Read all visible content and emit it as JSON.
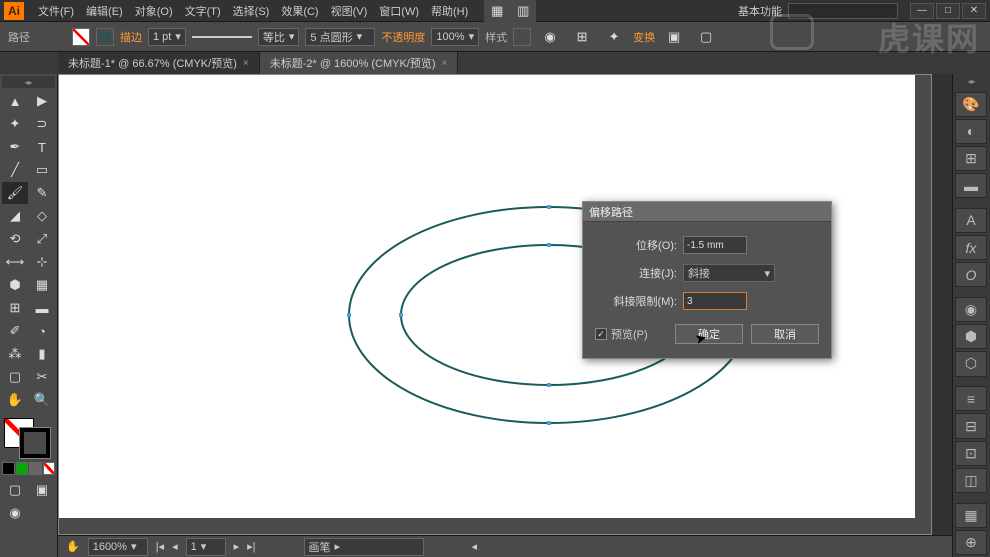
{
  "menubar": {
    "logo": "Ai",
    "items": [
      "文件(F)",
      "编辑(E)",
      "对象(O)",
      "文字(T)",
      "选择(S)",
      "效果(C)",
      "视图(V)",
      "窗口(W)",
      "帮助(H)"
    ],
    "workspace_label": "基本功能"
  },
  "controlbar": {
    "path_label": "路径",
    "stroke_label": "描边",
    "stroke_weight": "1 pt",
    "profile_label": "等比",
    "brush_label": "5 点圆形",
    "opacity_label": "不透明度",
    "opacity_value": "100%",
    "style_label": "样式",
    "transform_label": "变换"
  },
  "tabs": [
    {
      "label": "未标题-1* @ 66.67% (CMYK/预览)",
      "active": false
    },
    {
      "label": "未标题-2* @ 1600% (CMYK/预览)",
      "active": true
    }
  ],
  "dialog": {
    "title": "偏移路径",
    "offset_label": "位移(O):",
    "offset_value": "-1.5 mm",
    "join_label": "连接(J):",
    "join_value": "斜接",
    "miter_label": "斜接限制(M):",
    "miter_value": "3",
    "preview_label": "预览(P)",
    "preview_checked": "✓",
    "ok": "确定",
    "cancel": "取消"
  },
  "status": {
    "zoom": "1600%",
    "nav": "1",
    "tool": "画笔"
  },
  "colors": {
    "swatches": [
      "#000000",
      "#008800",
      "#666666",
      "#ffffff"
    ]
  }
}
